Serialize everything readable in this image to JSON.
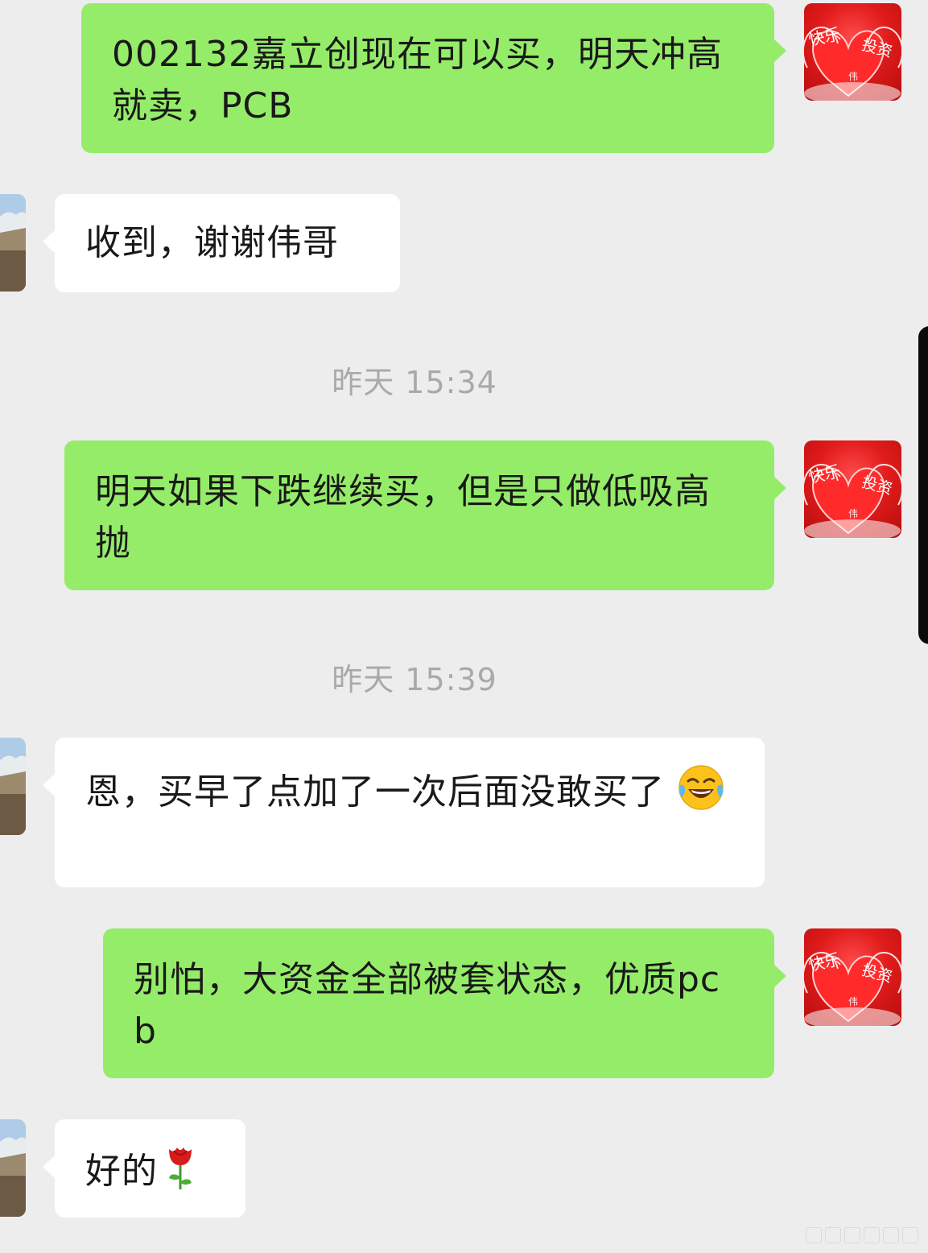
{
  "chat": {
    "messages": [
      {
        "from": "self",
        "text": "002132嘉立创现在可以买，明天冲高就卖，PCB"
      },
      {
        "from": "friend",
        "text": "收到，谢谢伟哥"
      },
      {
        "from": "self",
        "text": "明天如果下跌继续买，但是只做低吸高抛"
      },
      {
        "from": "friend",
        "text": "恩，买早了点加了一次后面没敢买了",
        "emoji": "face-with-tears-of-joy"
      },
      {
        "from": "self",
        "text": "别怕，大资金全部被套状态，优质pcb"
      },
      {
        "from": "friend",
        "text": "好的",
        "emoji": "rose"
      }
    ],
    "timestamps": [
      {
        "text": "昨天 15:34"
      },
      {
        "text": "昨天 15:39"
      }
    ],
    "self_avatar": {
      "icon": "hearts-avatar",
      "label_1": "快乐",
      "label_2": "投资",
      "label_3": "伟"
    },
    "friend_avatar": {
      "icon": "landscape-avatar"
    }
  },
  "colors": {
    "background": "#ededed",
    "self_bubble": "#95ec69",
    "friend_bubble": "#ffffff",
    "timestamp": "#a9a9a9"
  }
}
